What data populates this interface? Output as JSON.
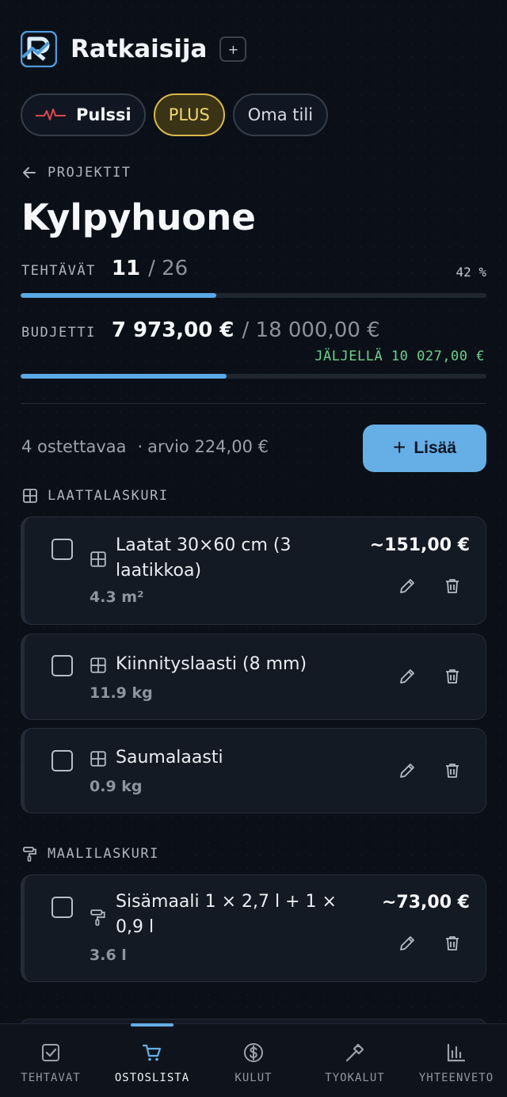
{
  "app": {
    "title": "Ratkaisija",
    "add_symbol": "+"
  },
  "pills": {
    "pulse": "Pulssi",
    "plus": "PLUS",
    "account": "Oma tili"
  },
  "breadcrumb": "PROJEKTIT",
  "project": {
    "title": "Kylpyhuone"
  },
  "tasks": {
    "label": "TEHTÄVÄT",
    "done": "11",
    "total": "/ 26",
    "percent_text": "42 %",
    "progress": 0.42
  },
  "budget": {
    "label": "BUDJETTI",
    "spent": "7 973,00 €",
    "total": "/ 18 000,00 €",
    "remaining": "JÄLJELLÄ 10 027,00 €",
    "progress": 0.443
  },
  "summary": {
    "count": "4 ostettavaa",
    "sep": "·",
    "estimate": "arvio 224,00 €"
  },
  "add_button": {
    "label": "Lisää"
  },
  "sections": [
    {
      "label": "LAATTALASKURI",
      "icon": "grid-icon"
    },
    {
      "label": "MAALILASKURI",
      "icon": "paint-roller-icon"
    }
  ],
  "items": [
    {
      "name_line1": "Laatat 30×60 cm (3",
      "name_line2": "laatikkoa)",
      "qty": "4.3 m²",
      "price": "~151,00 €",
      "icon": "grid-icon"
    },
    {
      "name_line1": "Kiinnityslaasti (8 mm)",
      "qty": "11.9 kg",
      "icon": "grid-icon"
    },
    {
      "name_line1": "Saumalaasti",
      "qty": "0.9 kg",
      "icon": "grid-icon"
    },
    {
      "name_line1": "Sisämaali 1 × 2,7 l + 1 ×",
      "name_line2": "0,9 l",
      "qty": "3.6 l",
      "price": "~73,00 €",
      "icon": "paint-roller-icon"
    }
  ],
  "nav": [
    {
      "label": "TEHTAVAT",
      "icon": "checkbox-icon"
    },
    {
      "label": "OSTOSLISTA",
      "icon": "cart-icon",
      "active": true
    },
    {
      "label": "KULUT",
      "icon": "dollar-icon"
    },
    {
      "label": "TYOKALUT",
      "icon": "hammer-icon"
    },
    {
      "label": "YHTEENVETO",
      "icon": "bar-chart-icon"
    }
  ],
  "colors": {
    "accent": "#66aee6",
    "plus_gold": "#d9b94a",
    "remaining_green": "#6fd08d",
    "background": "#0b1018"
  }
}
